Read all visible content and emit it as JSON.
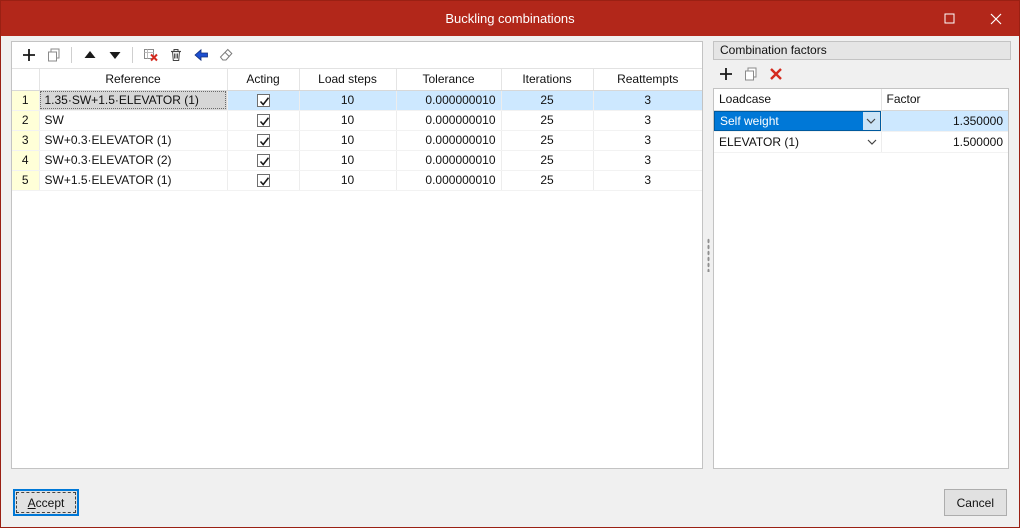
{
  "window": {
    "title": "Buckling combinations",
    "accent": "#b2271a"
  },
  "left": {
    "columns": {
      "reference": "Reference",
      "acting": "Acting",
      "load_steps": "Load steps",
      "tolerance": "Tolerance",
      "iterations": "Iterations",
      "reattempts": "Reattempts"
    },
    "rows": [
      {
        "num": "1",
        "reference": "1.35·SW+1.5·ELEVATOR (1)",
        "acting": true,
        "load_steps": "10",
        "tolerance": "0.000000010",
        "iterations": "25",
        "reattempts": "3",
        "selected": true
      },
      {
        "num": "2",
        "reference": "SW",
        "acting": true,
        "load_steps": "10",
        "tolerance": "0.000000010",
        "iterations": "25",
        "reattempts": "3",
        "selected": false
      },
      {
        "num": "3",
        "reference": "SW+0.3·ELEVATOR (1)",
        "acting": true,
        "load_steps": "10",
        "tolerance": "0.000000010",
        "iterations": "25",
        "reattempts": "3",
        "selected": false
      },
      {
        "num": "4",
        "reference": "SW+0.3·ELEVATOR (2)",
        "acting": true,
        "load_steps": "10",
        "tolerance": "0.000000010",
        "iterations": "25",
        "reattempts": "3",
        "selected": false
      },
      {
        "num": "5",
        "reference": "SW+1.5·ELEVATOR (1)",
        "acting": true,
        "load_steps": "10",
        "tolerance": "0.000000010",
        "iterations": "25",
        "reattempts": "3",
        "selected": false
      }
    ]
  },
  "right": {
    "title": "Combination factors",
    "columns": {
      "loadcase": "Loadcase",
      "factor": "Factor"
    },
    "rows": [
      {
        "loadcase": "Self weight",
        "factor": "1.350000",
        "selected": true
      },
      {
        "loadcase": "ELEVATOR (1)",
        "factor": "1.500000",
        "selected": false
      }
    ]
  },
  "buttons": {
    "accept_mnemonic": "A",
    "accept_rest": "ccept",
    "cancel": "Cancel"
  }
}
